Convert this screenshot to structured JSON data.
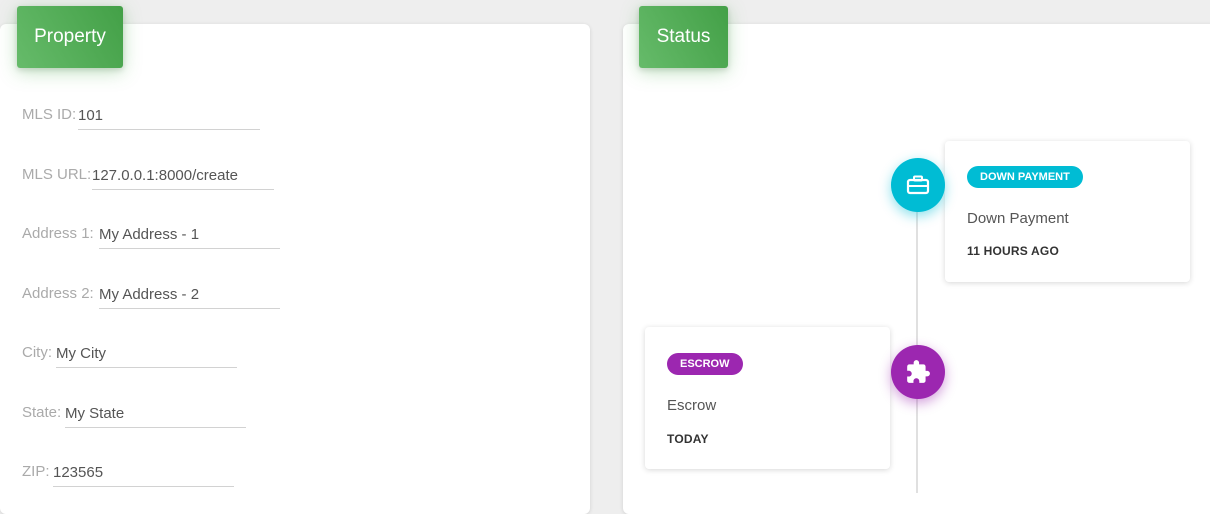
{
  "property": {
    "title": "Property",
    "fields": [
      {
        "label": "MLS ID:",
        "value": "101"
      },
      {
        "label": "MLS URL:",
        "value": "127.0.0.1:8000/create"
      },
      {
        "label": "Address 1:",
        "value": "My Address - 1"
      },
      {
        "label": "Address 2:",
        "value": "My Address - 2"
      },
      {
        "label": "City:",
        "value": "My City"
      },
      {
        "label": "State:",
        "value": "My State"
      },
      {
        "label": "ZIP:",
        "value": "123565"
      }
    ]
  },
  "status": {
    "title": "Status",
    "events": [
      {
        "badge": "DOWN PAYMENT",
        "body": "Down Payment",
        "time": "11 HOURS AGO",
        "color": "#00bcd4",
        "icon": "briefcase-icon"
      },
      {
        "badge": "ESCROW",
        "body": "Escrow",
        "time": "TODAY",
        "color": "#9c27b0",
        "icon": "puzzle-icon"
      }
    ]
  },
  "colors": {
    "header_green": "#4caf50",
    "cyan": "#00bcd4",
    "purple": "#9c27b0"
  }
}
